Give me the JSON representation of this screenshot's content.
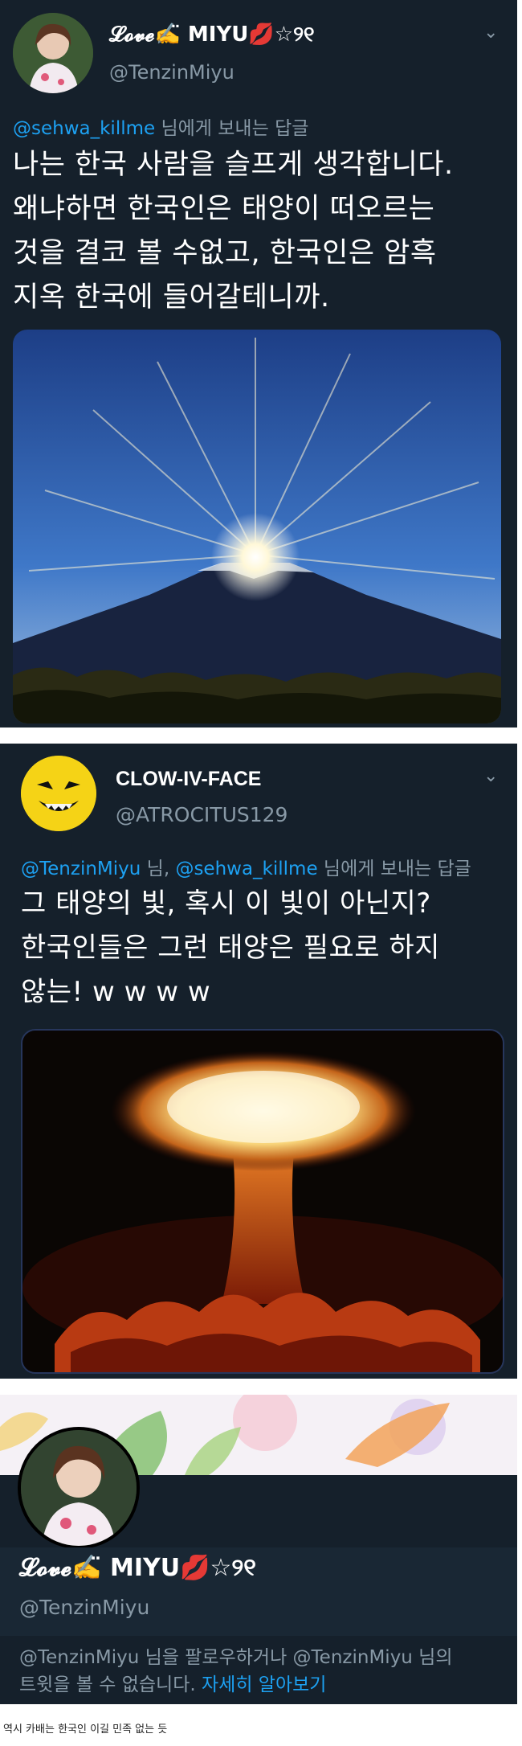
{
  "tweet1": {
    "display_name": "𝓛𝓸𝓿𝓮✍️̈ MIYU💋☆୨୧",
    "handle": "@TenzinMiyu",
    "reply_to": "@sehwa_killme",
    "reply_suffix": " 님에게 보내는 답글",
    "lines": [
      "나는 한국 사람을 슬프게 생각합니다.",
      "왜냐하면 한국인은 태양이 떠오르는",
      "것을 결코 볼 수없고, 한국인은 암흑",
      "지옥 한국에 들어갈테니까."
    ],
    "image_icon": "sunrise-over-mountain"
  },
  "tweet2": {
    "display_name": "CLOW-IV-FACE",
    "handle": "@ATROCITUS129",
    "reply_to_1": "@TenzinMiyu",
    "reply_sep": " 님, ",
    "reply_to_2": "@sehwa_killme",
    "reply_suffix": " 님에게 보내는 답글",
    "lines": [
      "그 태양의 빛, 혹시 이 빛이 아닌지?",
      "한국인들은 그런 태양은 필요로 하지",
      "않는! w w w w"
    ],
    "image_icon": "mushroom-cloud-explosion"
  },
  "profile": {
    "display_name": "𝓛𝓸𝓿𝓮✍️̈ MIYU💋☆୨୧",
    "handle": "@TenzinMiyu",
    "blocked_text_1": "@TenzinMiyu 님을 팔로우하거나 @TenzinMiyu 님의",
    "blocked_text_2": "트윗을 볼 수 없습니다. ",
    "learn_more": "자세히 알아보기"
  },
  "caption": "역시 카배는 한국인 이길 민족 없는 듯",
  "colors": {
    "background": "#15202b",
    "text": "#ffffff",
    "muted": "#8899a6",
    "link": "#1da1f2"
  }
}
